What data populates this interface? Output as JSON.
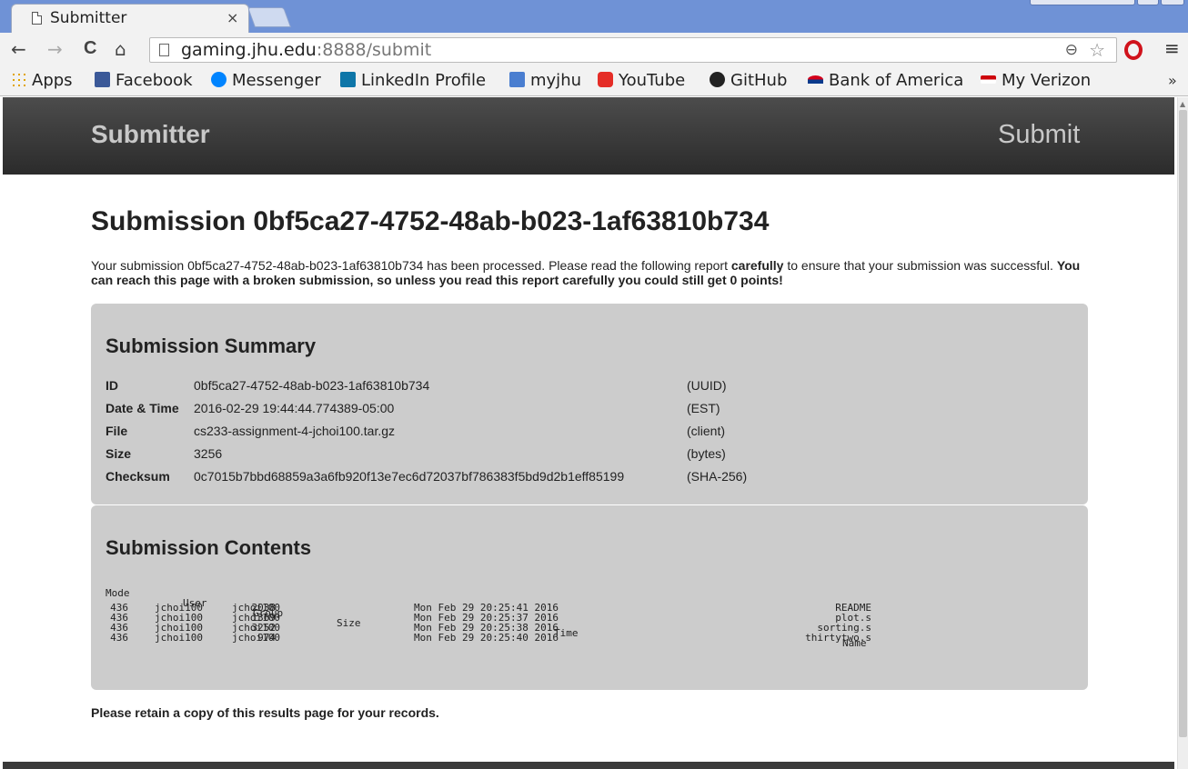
{
  "browser": {
    "tab_title": "Submitter",
    "tab_close": "×",
    "url_host": "gaming.jhu.edu",
    "url_rest": ":8888/submit",
    "back": "←",
    "forward": "→",
    "reload": "C",
    "home": "⌂",
    "zoom_icon": "⊖",
    "star_icon": "☆",
    "menu_icon": "≡",
    "more_bookmarks": "»",
    "bookmarks": [
      {
        "label": "Apps",
        "color": "#e0a400"
      },
      {
        "label": "Facebook",
        "color": "#3b5998"
      },
      {
        "label": "Messenger",
        "color": "#0084ff"
      },
      {
        "label": "LinkedIn Profile",
        "color": "#0e76a8"
      },
      {
        "label": "myjhu",
        "color": "#4a7ed0"
      },
      {
        "label": "YouTube",
        "color": "#e52d27"
      },
      {
        "label": "GitHub",
        "color": "#222222"
      },
      {
        "label": "Bank of America",
        "color": "#d4001a"
      },
      {
        "label": "My Verizon",
        "color": "#cd040b"
      }
    ]
  },
  "navbar": {
    "brand": "Submitter",
    "submit_link": "Submit"
  },
  "page": {
    "heading": "Submission 0bf5ca27-4752-48ab-b023-1af63810b734",
    "intro_1": "Your submission 0bf5ca27-4752-48ab-b023-1af63810b734 has been processed. Please read the following report ",
    "intro_bold_1": "carefully",
    "intro_2": " to ensure that your submission was successful. ",
    "intro_bold_2": "You can reach this page with a broken submission, so unless you read this report carefully you could still get 0 points!",
    "retain_note": "Please retain a copy of this results page for your records."
  },
  "summary": {
    "title": "Submission Summary",
    "rows": [
      {
        "key": "ID",
        "value": "0bf5ca27-4752-48ab-b023-1af63810b734",
        "unit": "(UUID)"
      },
      {
        "key": "Date & Time",
        "value": "2016-02-29 19:44:44.774389-05:00",
        "unit": "(EST)"
      },
      {
        "key": "File",
        "value": "cs233-assignment-4-jchoi100.tar.gz",
        "unit": "(client)"
      },
      {
        "key": "Size",
        "value": "3256",
        "unit": "(bytes)"
      },
      {
        "key": "Checksum",
        "value": "0c7015b7bbd68859a3a6fb920f13e7ec6d72037bf786383f5bd9d2b1eff85199",
        "unit": "(SHA-256)"
      }
    ]
  },
  "contents": {
    "title": "Submission Contents",
    "headers": {
      "mode": "Mode",
      "user": "User",
      "group": "Group",
      "size": "Size",
      "time": "Time",
      "name": "Name"
    },
    "rows": [
      {
        "mode": "436",
        "user": "jchoi100",
        "group": "jchoi100",
        "size": "2038",
        "time": "Mon Feb 29 20:25:41 2016",
        "name": "README"
      },
      {
        "mode": "436",
        "user": "jchoi100",
        "group": "jchoi100",
        "size": "1369",
        "time": "Mon Feb 29 20:25:37 2016",
        "name": "plot.s"
      },
      {
        "mode": "436",
        "user": "jchoi100",
        "group": "jchoi100",
        "size": "3252",
        "time": "Mon Feb 29 20:25:38 2016",
        "name": "sorting.s"
      },
      {
        "mode": "436",
        "user": "jchoi100",
        "group": "jchoi100",
        "size": "974",
        "time": "Mon Feb 29 20:25:40 2016",
        "name": "thirtytwo.s"
      }
    ]
  }
}
